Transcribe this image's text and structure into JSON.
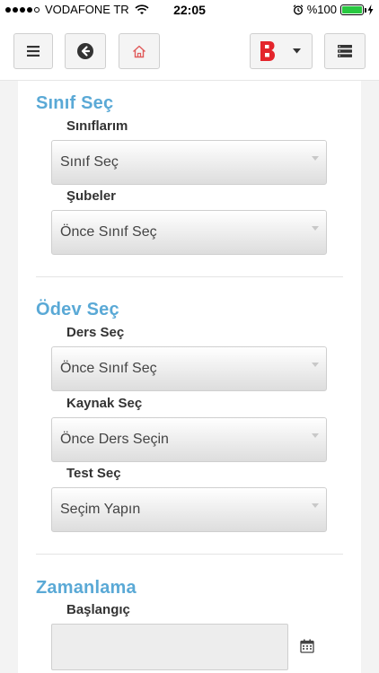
{
  "statusbar": {
    "carrier": "VODAFONE TR",
    "time": "22:05",
    "battery": "%100",
    "battery_level": 1.0,
    "icons": [
      "signal-icon",
      "wifi-icon",
      "alarm-icon",
      "battery-icon",
      "charging-icon"
    ]
  },
  "toolbar": {
    "icons": {
      "menu": "hamburger-icon",
      "back": "arrow-left-circle-icon",
      "home": "home-icon",
      "brand": "b-logo",
      "brand_dropdown": "caret-down-icon",
      "list": "list-view-icon"
    },
    "brand_letter": "B",
    "colors": {
      "brand_red": "#e4252c",
      "home_red": "#e05b5b"
    }
  },
  "sections": {
    "class": {
      "title": "Sınıf Seç",
      "fields": {
        "classes": {
          "label": "Sınıflarım",
          "value": "Sınıf Seç"
        },
        "branches": {
          "label": "Şubeler",
          "value": "Önce Sınıf Seç"
        }
      }
    },
    "homework": {
      "title": "Ödev Seç",
      "fields": {
        "course": {
          "label": "Ders Seç",
          "value": "Önce Sınıf Seç"
        },
        "source": {
          "label": "Kaynak Seç",
          "value": "Önce Ders Seçin"
        },
        "test": {
          "label": "Test Seç",
          "value": "Seçim Yapın"
        }
      }
    },
    "schedule": {
      "title": "Zamanlama",
      "fields": {
        "start": {
          "label": "Başlangıç",
          "value": ""
        }
      }
    }
  },
  "colors": {
    "accent": "#5aa9d6",
    "page_bg": "#f3f3f3"
  }
}
